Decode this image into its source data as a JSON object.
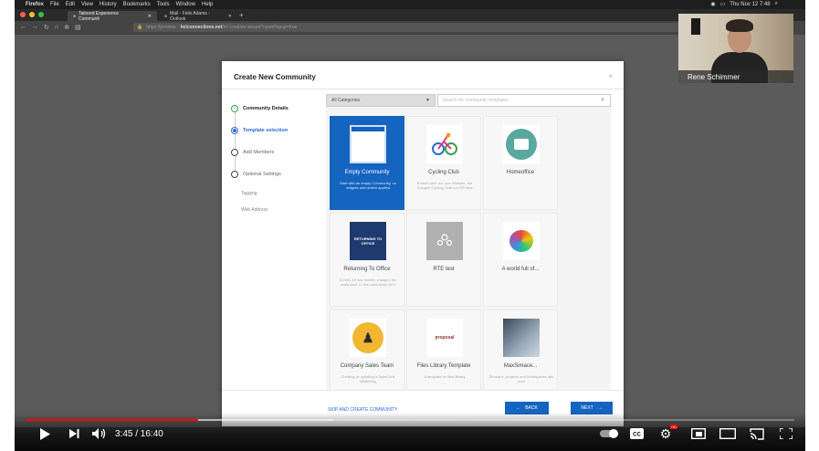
{
  "menubar": {
    "app": "Firefox",
    "items": [
      "File",
      "Edit",
      "View",
      "History",
      "Bookmarks",
      "Tools",
      "Window",
      "Help"
    ],
    "clock": "Thu Nov 12  7:48"
  },
  "browser": {
    "tabs": [
      {
        "label": "Tailored Experience Communit",
        "active": true
      },
      {
        "label": "Mail - Felix Adams - Outlook",
        "active": false
      }
    ],
    "url_prefix": "https://preview.",
    "url_domain": "hclconnections.net",
    "url_path": "/hc-creation-wizard?openPopup=true"
  },
  "modal": {
    "title": "Create New Community",
    "close": "×",
    "steps": [
      {
        "label": "Community Details",
        "state": "done"
      },
      {
        "label": "Template selection",
        "state": "active"
      },
      {
        "label": "Add Members",
        "state": "todo"
      },
      {
        "label": "Optional Settings",
        "state": "todo"
      }
    ],
    "sub_steps": [
      "Tagging",
      "Web Address"
    ],
    "category_select": "All Categories",
    "search_placeholder": "Search for community templates",
    "templates": [
      {
        "title": "Empty Community",
        "desc": "Start with an empty Community, no widgets and review applied",
        "selected": true,
        "icon": "empty-window"
      },
      {
        "title": "Cycling Club",
        "desc": "Embed here our own Website, the Cologne Cycling Club a.k.FIR eles",
        "selected": false,
        "icon": "cyclist"
      },
      {
        "title": "Homeoffice",
        "desc": "",
        "selected": false,
        "icon": "book-club"
      },
      {
        "title": "Returning To Office",
        "desc": "COVID-19 has forever changed the workplace. In this community we'll",
        "selected": false,
        "icon": "returning-to-office",
        "image_text": "RETURNING TO OFFICE"
      },
      {
        "title": "RTE test",
        "desc": "",
        "selected": false,
        "icon": "group"
      },
      {
        "title": "A world full of...",
        "desc": "",
        "selected": false,
        "icon": "brain"
      },
      {
        "title": "Company Sales Team",
        "desc": "Creating or updating a Sales Unit Marketing",
        "selected": false,
        "icon": "sales-team"
      },
      {
        "title": "Files Library Template",
        "desc": "A template for files library",
        "selected": false,
        "icon": "word-cloud",
        "image_text": "proposal"
      },
      {
        "title": "MaxSimace...",
        "desc": "Structure, projects and Workspaces into your",
        "selected": false,
        "icon": "building"
      }
    ],
    "footer": {
      "skip": "SKIP AND CREATE COMMUNITY",
      "back": "BACK",
      "next": "NEXT"
    }
  },
  "webcam": {
    "name": "Rene Schimmer"
  },
  "player": {
    "time": "3:45 / 16:40",
    "progress": 0.225,
    "buffered": 0.4,
    "hd_badge": "HD"
  },
  "colors": {
    "accent": "#1564c0",
    "progress": "#ff0000",
    "done": "#3a9a5a"
  }
}
